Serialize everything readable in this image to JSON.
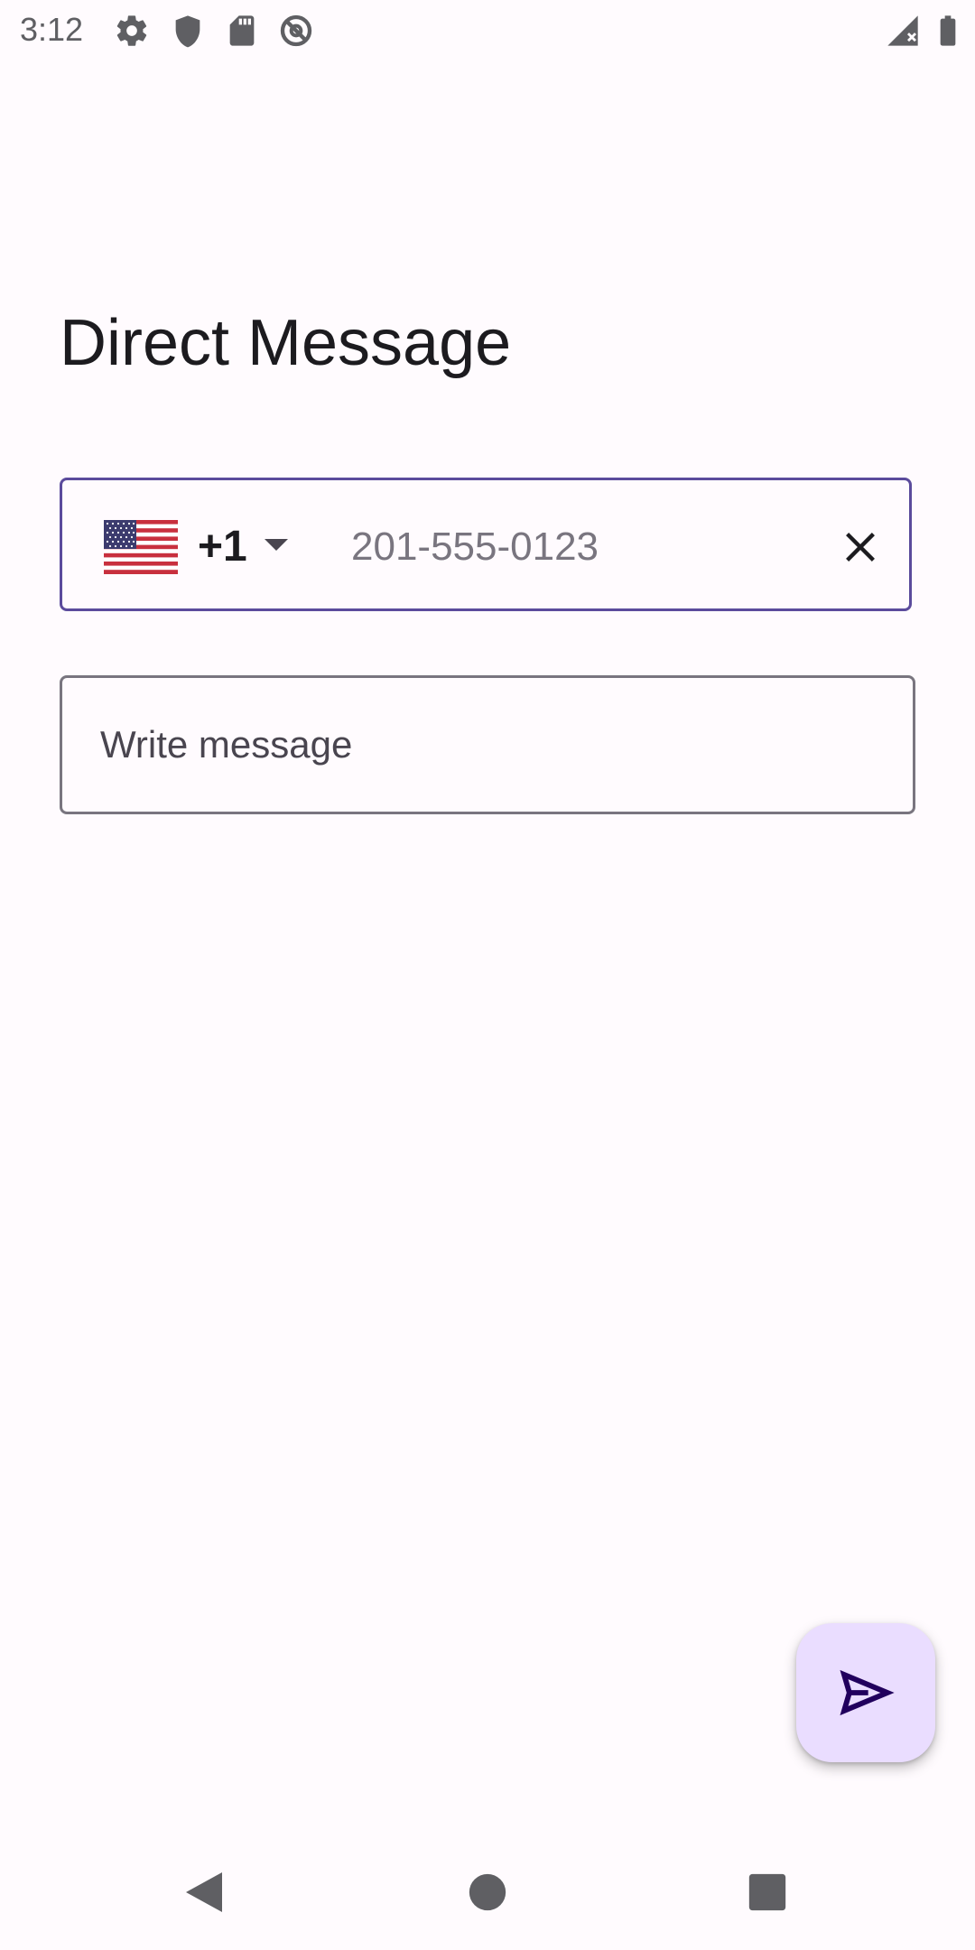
{
  "status_bar": {
    "time": "3:12",
    "icons": [
      "gear-icon",
      "shield-icon",
      "sd-card-icon",
      "no-sync-icon",
      "signal-icon",
      "battery-icon"
    ]
  },
  "page": {
    "title": "Direct Message"
  },
  "phone_field": {
    "country_flag": "us-flag-icon",
    "country_code": "+1",
    "placeholder": "201-555-0123",
    "value": "",
    "border_color": "#5b4b9c"
  },
  "message_field": {
    "placeholder": "Write message",
    "value": ""
  },
  "send_button": {
    "icon": "send-icon",
    "background": "#eaddff",
    "icon_color": "#21005d"
  },
  "nav_bar": {
    "buttons": [
      "back-icon",
      "home-icon",
      "recents-icon"
    ]
  }
}
